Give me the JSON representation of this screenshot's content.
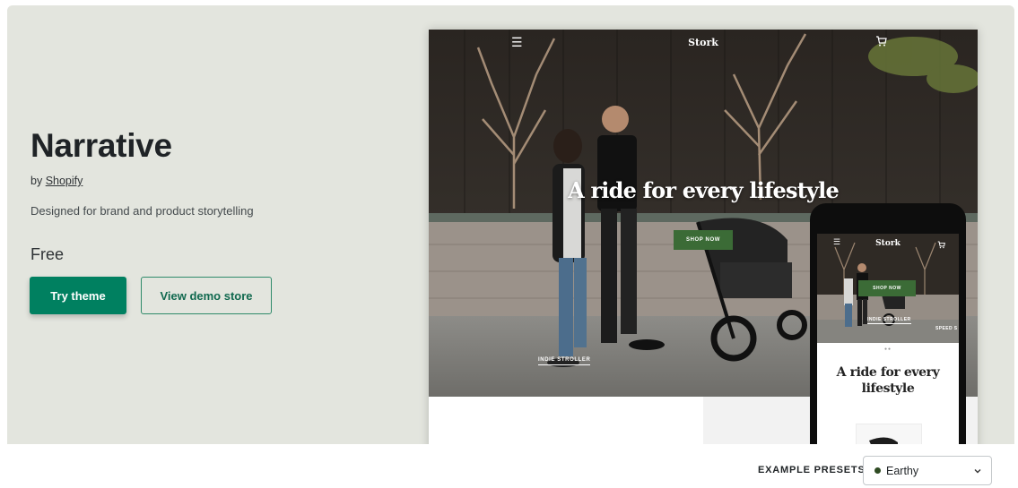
{
  "theme": {
    "name": "Narrative",
    "by_prefix": "by",
    "author": "Shopify",
    "description": "Designed for brand and product storytelling",
    "price": "Free"
  },
  "actions": {
    "try_label": "Try theme",
    "demo_label": "View demo store"
  },
  "preview": {
    "store_name": "Stork",
    "headline": "A ride for every lifestyle",
    "shop_now": "SHOP NOW",
    "collection_label": "INDIE STROLLER",
    "mobile_collection_label": "INDIE STROLLER",
    "mobile_second_label": "SPEED S",
    "mobile_headline_line1": "A ride for every",
    "mobile_headline_line2": "lifestyle"
  },
  "presets": {
    "label": "EXAMPLE PRESETS",
    "selected": "Earthy",
    "selected_color": "#2e4a22"
  },
  "colors": {
    "hero_bg": "#e3e5de",
    "primary": "#008060",
    "accent_green": "#3b6b36"
  },
  "icons": {
    "menu": "hamburger-menu-icon",
    "cart": "shopping-cart-icon",
    "dropdown": "chevron-down-icon"
  }
}
